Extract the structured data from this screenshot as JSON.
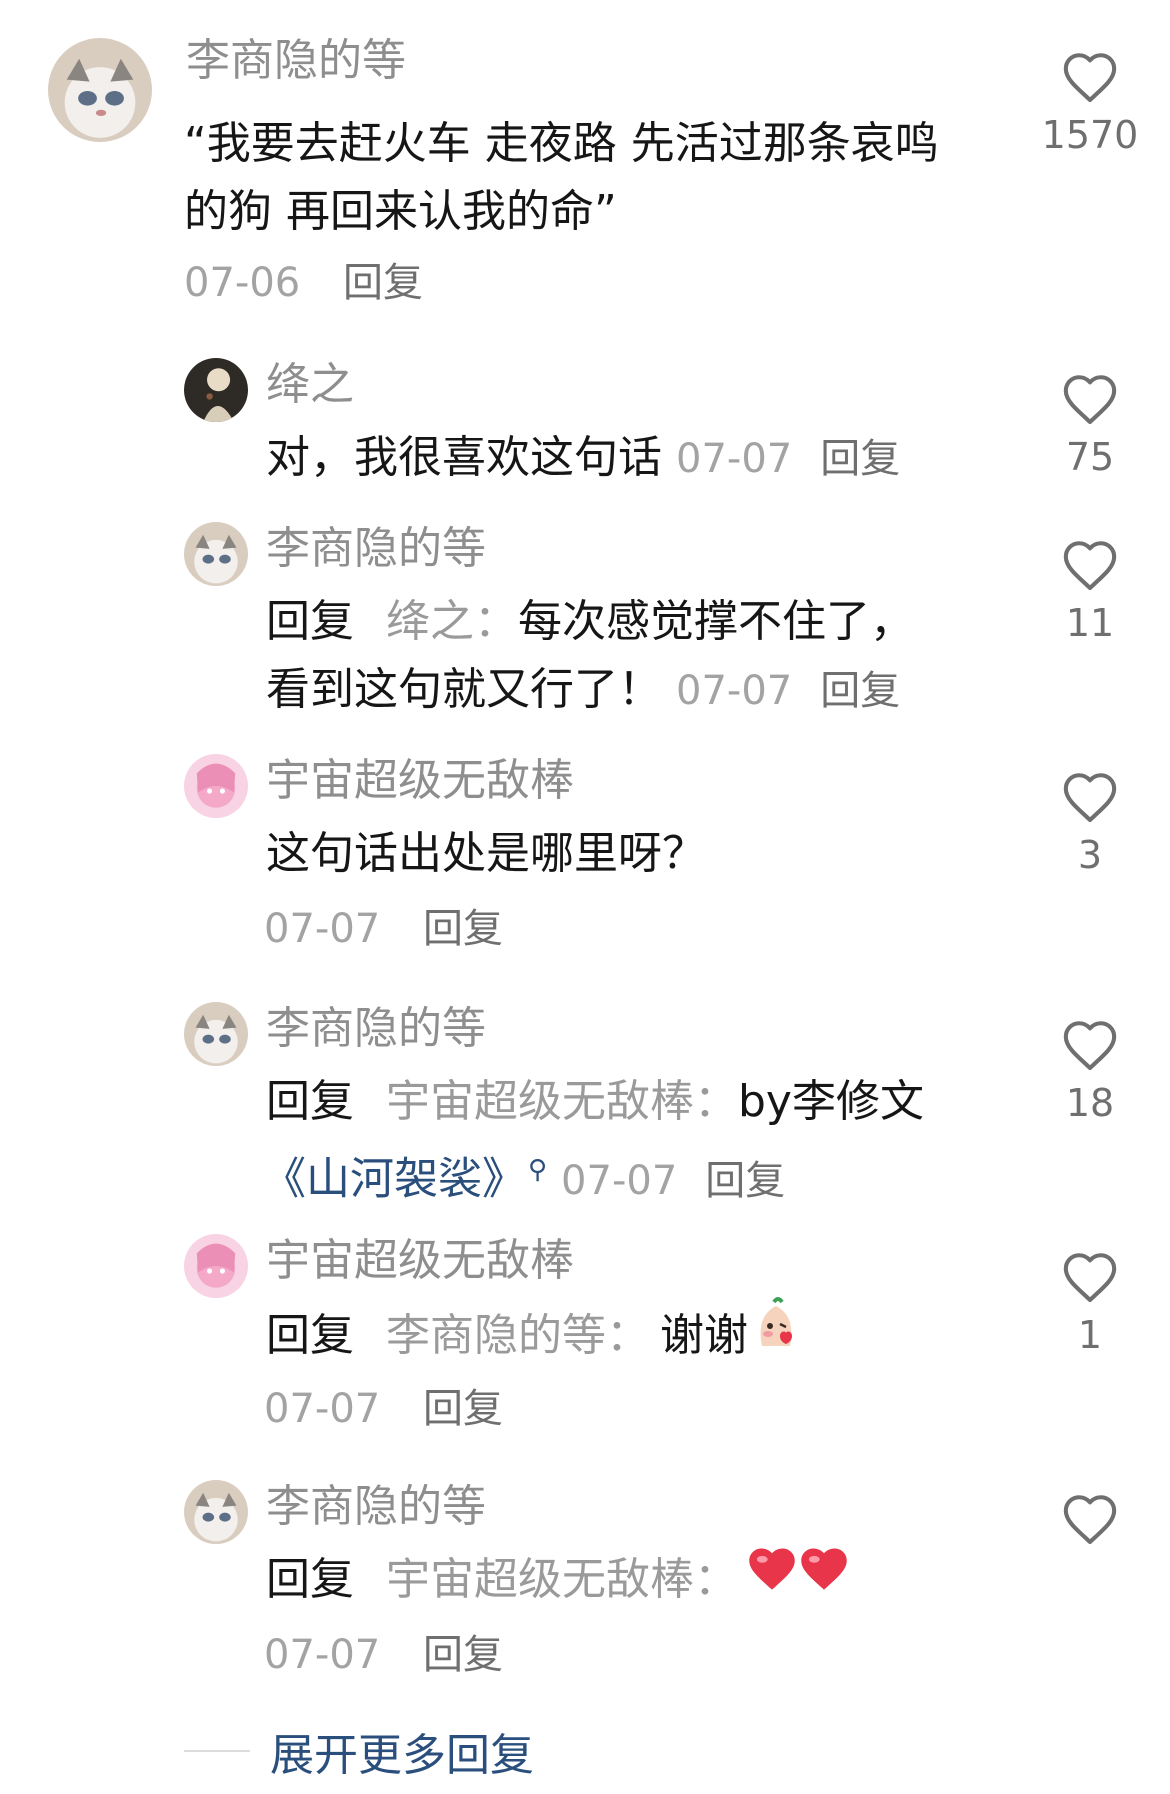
{
  "comment": {
    "user": "李商隐的等",
    "text": "“我要去赶火车 走夜路 先活过那条哀鸣的狗 再回来认我的命”",
    "date": "07-06",
    "reply_label": "回复",
    "likes": "1570"
  },
  "replies": [
    {
      "user": "绛之",
      "text": "对，我很喜欢这句话",
      "date": "07-07",
      "reply_label": "回复",
      "likes": "75"
    },
    {
      "user": "李商隐的等",
      "prefix": "回复",
      "target": "绛之：",
      "text_line1": "每次感觉撑不住了，",
      "text_line2": "看到这句就又行了！",
      "date": "07-07",
      "reply_label": "回复",
      "likes": "11"
    },
    {
      "user": "宇宙超级无敌棒",
      "text": "这句话出处是哪里呀？",
      "date": "07-07",
      "reply_label": "回复",
      "likes": "3"
    },
    {
      "user": "李商隐的等",
      "prefix": "回复",
      "target": "宇宙超级无敌棒：",
      "text": "by李修文",
      "link": "《山河袈裟》",
      "date": "07-07",
      "reply_label": "回复",
      "likes": "18"
    },
    {
      "user": "宇宙超级无敌棒",
      "prefix": "回复",
      "target": "李商隐的等：",
      "text": "谢谢",
      "date": "07-07",
      "reply_label": "回复",
      "likes": "1"
    },
    {
      "user": "李商隐的等",
      "prefix": "回复",
      "target": "宇宙超级无敌棒：",
      "date": "07-07",
      "reply_label": "回复",
      "likes": ""
    }
  ],
  "expand_label": "展开更多回复",
  "colors": {
    "username": "#8e8e8e",
    "body": "#161616",
    "link": "#2b4f7c",
    "heart_outline": "#6f6f6f",
    "red_heart": "#e8354a"
  },
  "icons": [
    "heart-outline-icon",
    "red-heart-emoji",
    "blush-emoji",
    "search-icon"
  ]
}
